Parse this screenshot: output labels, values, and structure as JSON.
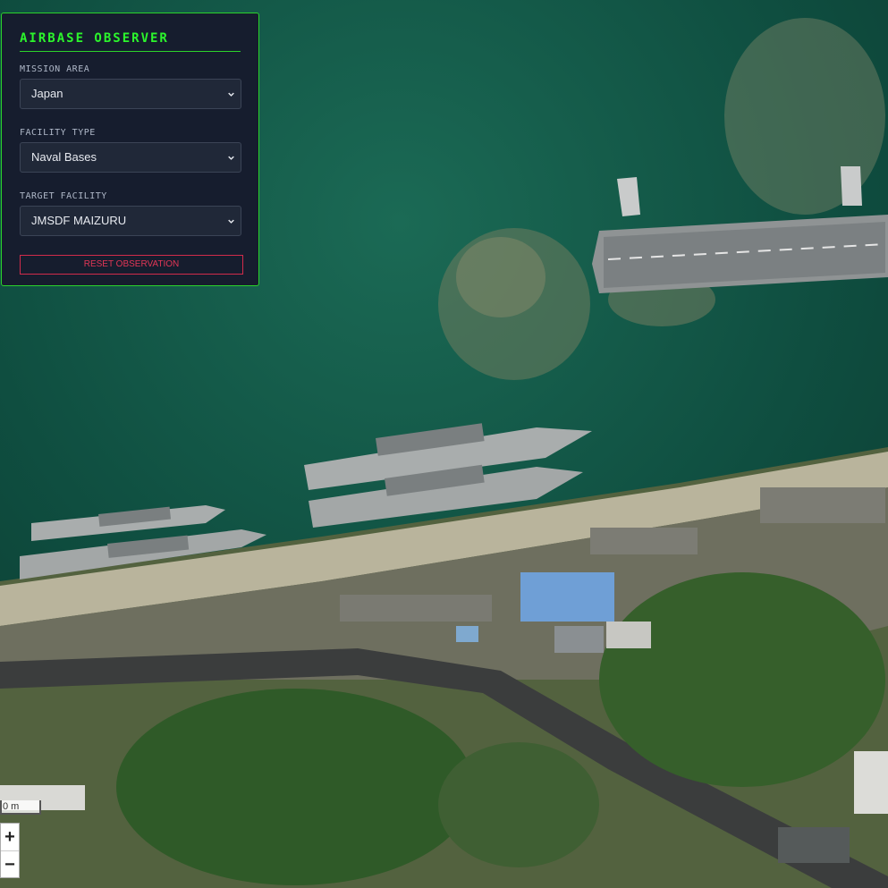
{
  "panel": {
    "title": "AIRBASE OBSERVER",
    "mission_area": {
      "label": "MISSION AREA",
      "value": "Japan"
    },
    "facility_type": {
      "label": "FACILITY TYPE",
      "value": "Naval Bases"
    },
    "target_facility": {
      "label": "TARGET FACILITY",
      "value": "JMSDF MAIZURU"
    },
    "reset_label": "RESET OBSERVATION"
  },
  "map": {
    "scale_label": "0 m",
    "zoom_in": "+",
    "zoom_out": "−"
  },
  "colors": {
    "panel_border": "#2bd32b",
    "title_green": "#2cf52c",
    "reset_red": "#d12b4b",
    "water": "#0f4a3c"
  },
  "icons": [
    "chevron-down-icon",
    "plus-icon",
    "minus-icon"
  ]
}
